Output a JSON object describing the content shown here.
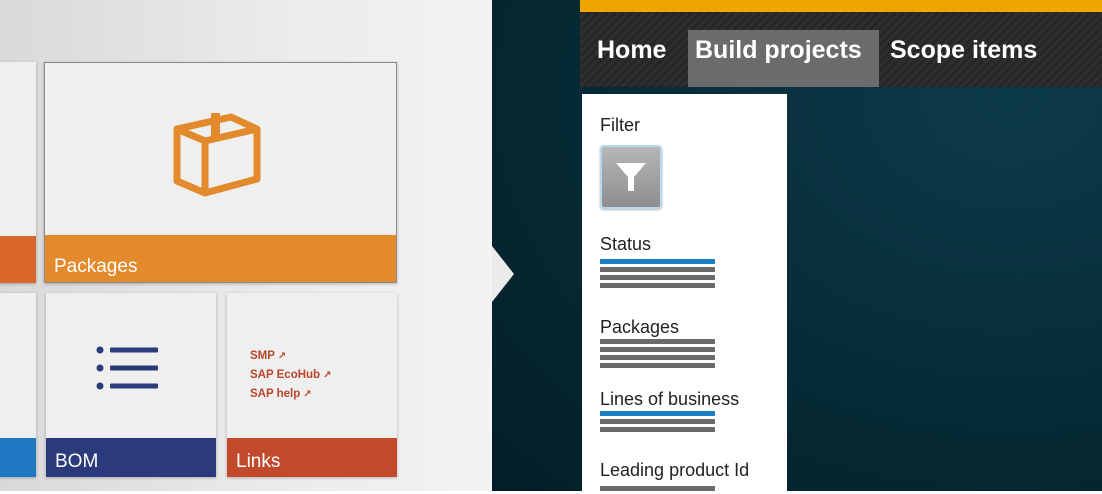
{
  "tiles": {
    "packages": {
      "label": "Packages",
      "color": "#e28a2c"
    },
    "bom": {
      "label": "BOM",
      "color": "#2b3a7a"
    },
    "links": {
      "label": "Links",
      "color": "#c24a2c",
      "items": [
        "SMP",
        "SAP EcoHub",
        "SAP help"
      ],
      "external_glyph": "↗"
    },
    "partial_top_color": "#d9662a",
    "partial_bottom_color": "#1f79c2"
  },
  "nav": {
    "top_strip_color": "#f0a500",
    "items": [
      {
        "label": "Home"
      },
      {
        "label": "Build projects",
        "active": true
      },
      {
        "label": "Scope items"
      }
    ]
  },
  "filter_panel": {
    "filter_label": "Filter",
    "sections": [
      {
        "label": "Status",
        "lines": [
          "blue",
          "gray",
          "gray",
          "gray"
        ]
      },
      {
        "label": "Packages",
        "lines": [
          "gray",
          "gray",
          "gray",
          "gray"
        ]
      },
      {
        "label": "Lines of business",
        "lines": [
          "blue",
          "gray",
          "gray"
        ]
      },
      {
        "label": "Leading product Id",
        "lines": [
          "gray"
        ]
      }
    ]
  }
}
